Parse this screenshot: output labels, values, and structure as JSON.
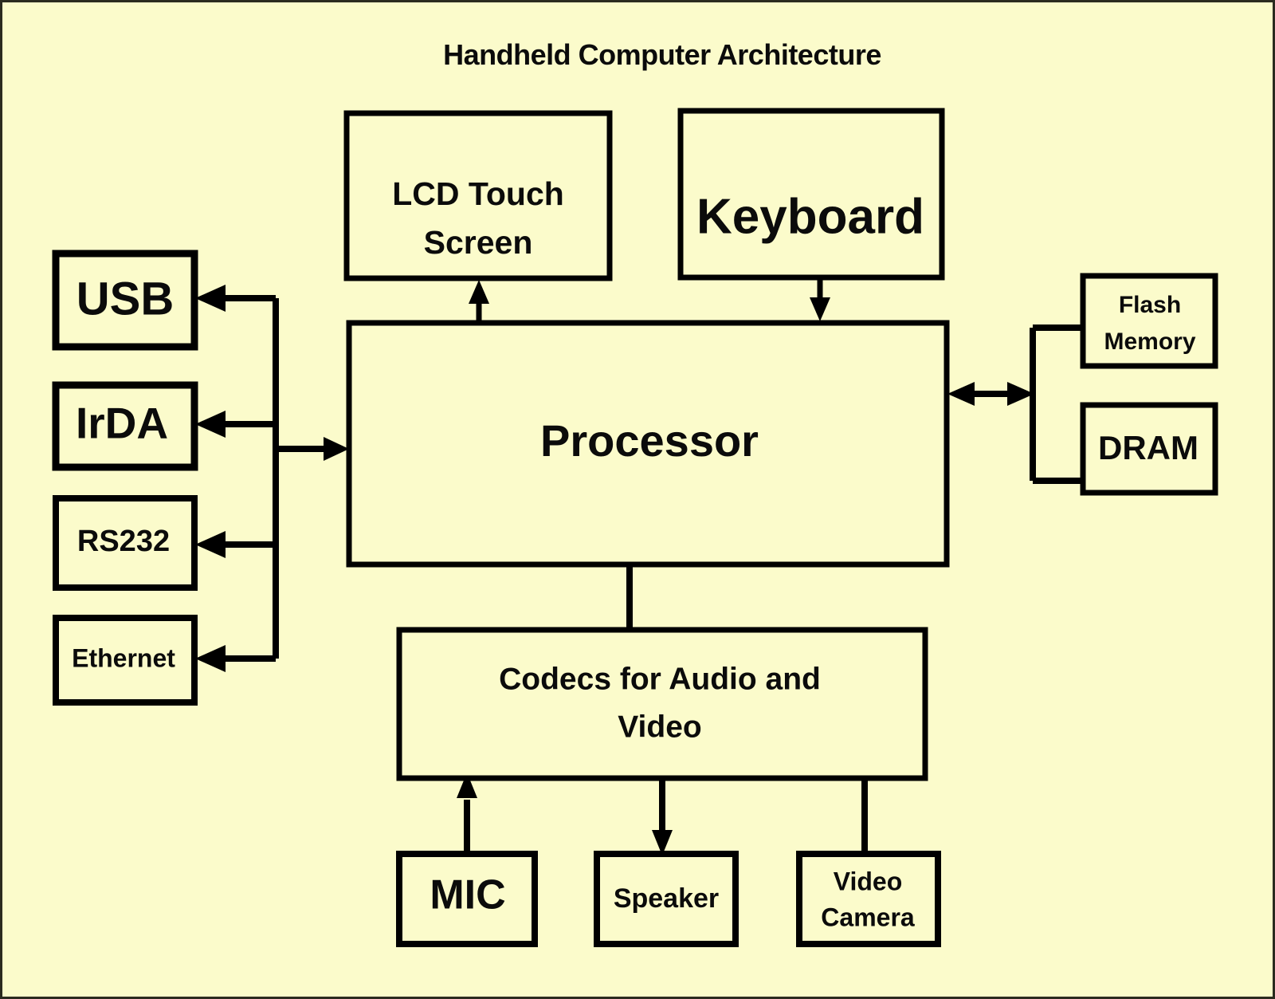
{
  "diagram": {
    "title": "Handheld Computer Architecture",
    "background_color": "#fbfbcb",
    "line_color": "#000000",
    "text_color": "#0b0b0b",
    "border_color": "#2b2b1f",
    "type": "block-diagram"
  },
  "nodes": {
    "lcd": {
      "label_line1": "LCD Touch",
      "label_line2": "Screen"
    },
    "keyboard": {
      "label": "Keyboard"
    },
    "processor": {
      "label": "Processor"
    },
    "usb": {
      "label": "USB"
    },
    "irda": {
      "label": "IrDA"
    },
    "rs232": {
      "label": "RS232"
    },
    "ethernet": {
      "label": "Ethernet"
    },
    "flash": {
      "label_line1": "Flash",
      "label_line2": "Memory"
    },
    "dram": {
      "label": "DRAM"
    },
    "codecs": {
      "label_line1": "Codecs for Audio and",
      "label_line2": "Video"
    },
    "mic": {
      "label": "MIC"
    },
    "speaker": {
      "label": "Speaker"
    },
    "camera": {
      "label_line1": "Video",
      "label_line2": "Camera"
    }
  },
  "connections": [
    {
      "from": "processor",
      "to": "lcd",
      "style": "arrow-up"
    },
    {
      "from": "keyboard",
      "to": "processor",
      "style": "arrow-down"
    },
    {
      "from": "io-bus",
      "to": "usb",
      "style": "arrow-left"
    },
    {
      "from": "io-bus",
      "to": "irda",
      "style": "arrow-left"
    },
    {
      "from": "io-bus",
      "to": "rs232",
      "style": "arrow-left"
    },
    {
      "from": "io-bus",
      "to": "ethernet",
      "style": "arrow-left"
    },
    {
      "from": "io-bus",
      "to": "processor",
      "style": "arrow-right"
    },
    {
      "from": "processor",
      "to": "memory-bus",
      "style": "double-arrow"
    },
    {
      "from": "memory-bus",
      "to": "flash",
      "style": "line"
    },
    {
      "from": "memory-bus",
      "to": "dram",
      "style": "line"
    },
    {
      "from": "processor",
      "to": "codecs",
      "style": "line"
    },
    {
      "from": "mic",
      "to": "codecs",
      "style": "arrow-up"
    },
    {
      "from": "codecs",
      "to": "speaker",
      "style": "arrow-down"
    },
    {
      "from": "camera",
      "to": "codecs",
      "style": "line"
    }
  ]
}
